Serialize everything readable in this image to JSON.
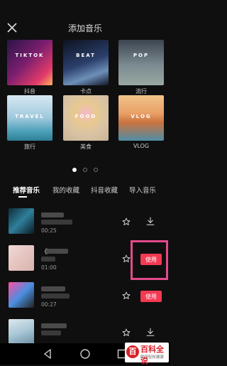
{
  "header": {
    "title": "添加音乐",
    "close_icon": "close-icon"
  },
  "categories": [
    {
      "label": "抖音",
      "overlay": "TIKTOK"
    },
    {
      "label": "卡点",
      "overlay": "BEAT"
    },
    {
      "label": "流行",
      "overlay": "POP"
    },
    {
      "label": "旅行",
      "overlay": "TRAVEL"
    },
    {
      "label": "美食",
      "overlay": "FOOD"
    },
    {
      "label": "VLOG",
      "overlay": "VLOG"
    }
  ],
  "pager": {
    "pages": 3,
    "active": 0
  },
  "tabs": [
    {
      "label": "推荐音乐",
      "active": true
    },
    {
      "label": "我的收藏",
      "active": false
    },
    {
      "label": "抖音收藏",
      "active": false
    },
    {
      "label": "导入音乐",
      "active": false
    }
  ],
  "songs": [
    {
      "title_visible": "恩…",
      "duration": "00:25",
      "action": "download"
    },
    {
      "title_visible": "《",
      "duration": "01:00",
      "action": "use",
      "action_label": "使用"
    },
    {
      "title_visible": "",
      "duration": "00:27",
      "action": "use",
      "action_label": "使用"
    },
    {
      "title_visible": "",
      "duration": "",
      "action": "download"
    }
  ],
  "watermark": {
    "title": "百科全说",
    "subtitle": "助您轻松健康"
  },
  "colors": {
    "accent": "#f23a52",
    "highlight": "#e24a8a",
    "background": "#0f0f10"
  }
}
